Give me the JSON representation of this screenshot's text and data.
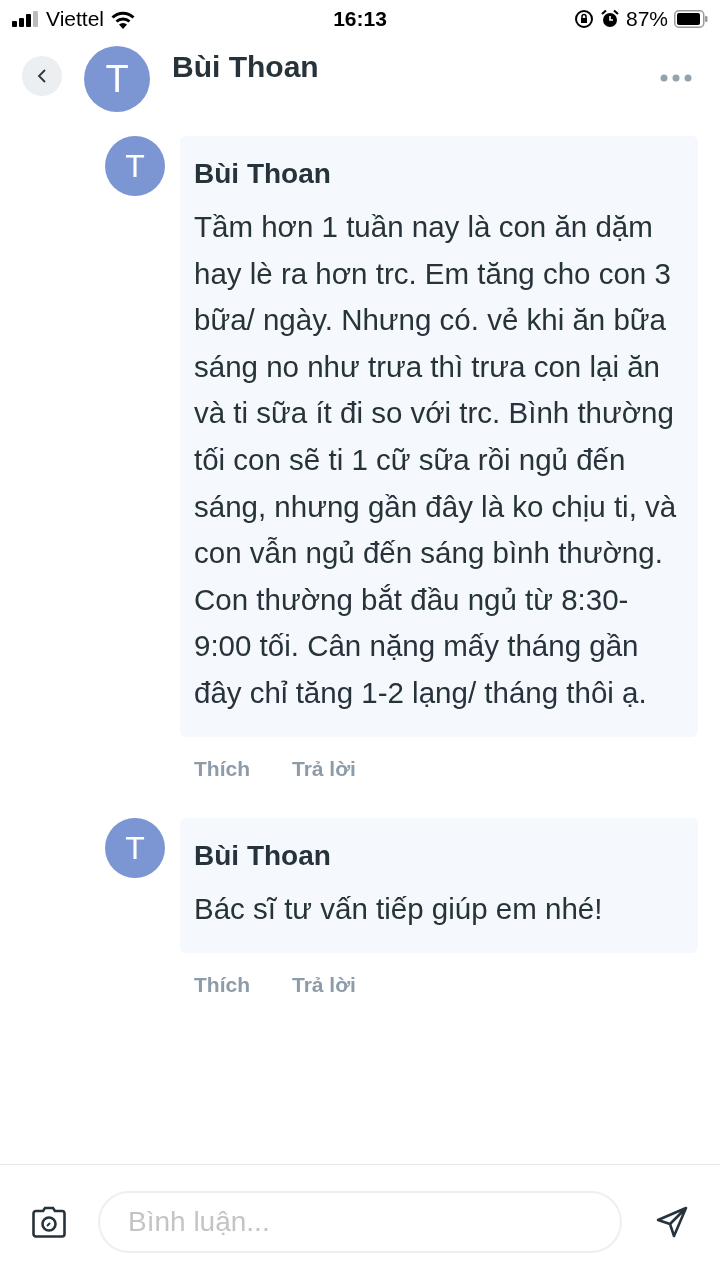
{
  "status_bar": {
    "carrier": "Viettel",
    "time": "16:13",
    "battery": "87%"
  },
  "header": {
    "avatar_letter": "T",
    "name": "Bùi Thoan"
  },
  "comments": [
    {
      "avatar_letter": "T",
      "author": "Bùi Thoan",
      "text": "Tầm hơn 1 tuần nay là con ăn dặm hay lè ra hơn trc. Em tăng cho con 3 bữa/ ngày. Nhưng có. vẻ khi ăn bữa sáng no như trưa thì trưa con lại ăn và ti sữa ít đi so với trc. Bình thường tối con sẽ ti 1 cữ sữa rồi ngủ đến sáng, nhưng gần đây là ko chịu ti, và con vẫn ngủ đến sáng bình thường. Con thường bắt đầu ngủ từ 8:30-9:00 tối. Cân nặng mấy tháng gần đây chỉ tăng 1-2 lạng/ tháng thôi ạ.",
      "actions": [
        "Thích",
        "Trả lời"
      ]
    },
    {
      "avatar_letter": "T",
      "author": "Bùi Thoan",
      "text": "Bác sĩ tư vấn tiếp giúp em nhé!",
      "actions": [
        "Thích",
        "Trả lời"
      ]
    }
  ],
  "composer": {
    "placeholder": "Bình luận..."
  }
}
